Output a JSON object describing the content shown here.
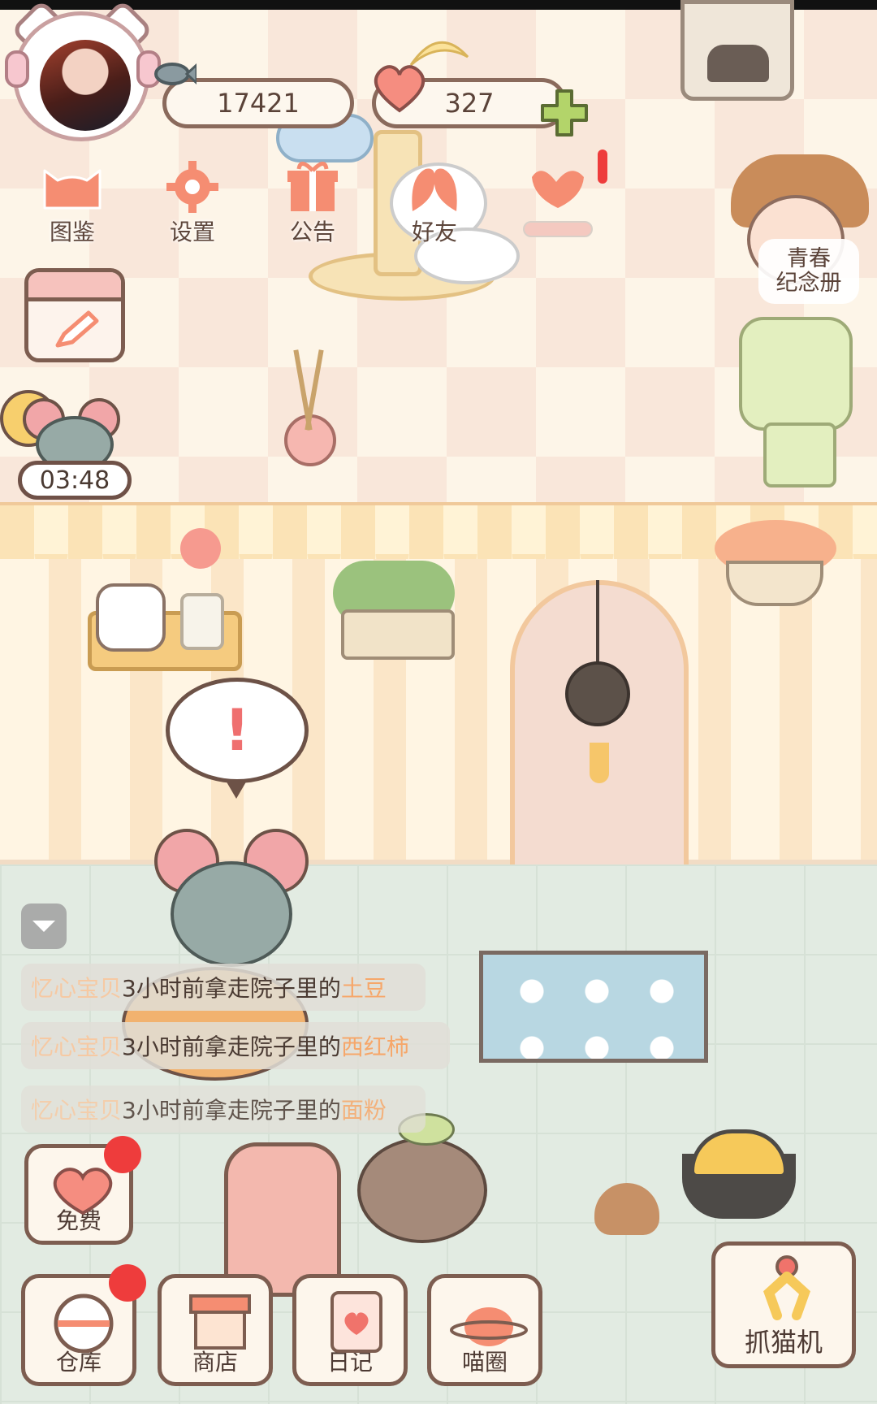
{
  "hud": {
    "fish_coins": "17421",
    "hearts": "327"
  },
  "menu": {
    "items": [
      {
        "label": "图鉴",
        "icon": "cat-head-icon"
      },
      {
        "label": "设置",
        "icon": "gear-icon"
      },
      {
        "label": "公告",
        "icon": "gift-icon"
      },
      {
        "label": "好友",
        "icon": "friends-icon"
      }
    ],
    "extra_icon": "mail-heart-icon"
  },
  "youth_album": {
    "line1": "青春",
    "line2": "纪念册"
  },
  "timer": "03:48",
  "feed": [
    {
      "name": "忆心宝贝",
      "text": "3小时前拿走院子里的",
      "item": "土豆"
    },
    {
      "name": "忆心宝贝",
      "text": "3小时前拿走院子里的",
      "item": "西红柿"
    },
    {
      "name": "忆心宝贝",
      "text": "3小时前拿走院子里的",
      "item": "面粉"
    }
  ],
  "bottom": {
    "free": "免费",
    "warehouse": "仓库",
    "shop": "商店",
    "diary": "日记",
    "circle": "喵圈",
    "claw": "抓猫机"
  },
  "bubble_mark": "!",
  "colors": {
    "accent": "#f58d72",
    "outline": "#7d5d50",
    "notify": "#ee3c3c"
  }
}
